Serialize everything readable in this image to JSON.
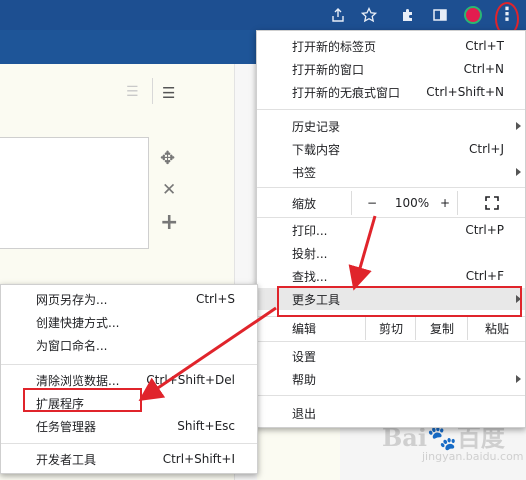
{
  "toolbar": {
    "icons": [
      "share-icon",
      "star-icon",
      "extensions-icon",
      "side-panel-icon",
      "profile-avatar",
      "more-menu-icon"
    ],
    "profile_ring_color": "#2bb673",
    "profile_fill_color": "#e21d4f",
    "more_icon_glyph": "⋮"
  },
  "main_menu": {
    "new_tab": {
      "label": "打开新的标签页",
      "shortcut": "Ctrl+T"
    },
    "new_window": {
      "label": "打开新的窗口",
      "shortcut": "Ctrl+N"
    },
    "new_incognito": {
      "label": "打开新的无痕式窗口",
      "shortcut": "Ctrl+Shift+N"
    },
    "history": {
      "label": "历史记录"
    },
    "downloads": {
      "label": "下载内容",
      "shortcut": "Ctrl+J"
    },
    "bookmarks": {
      "label": "书签"
    },
    "zoom": {
      "label": "缩放",
      "minus": "−",
      "level": "100%",
      "plus": "+"
    },
    "print": {
      "label": "打印...",
      "shortcut": "Ctrl+P"
    },
    "cast": {
      "label": "投射..."
    },
    "find": {
      "label": "查找...",
      "shortcut": "Ctrl+F"
    },
    "more_tools": {
      "label": "更多工具"
    },
    "edit": {
      "label": "编辑",
      "cut": "剪切",
      "copy": "复制",
      "paste": "粘贴"
    },
    "settings": {
      "label": "设置"
    },
    "help": {
      "label": "帮助"
    },
    "exit": {
      "label": "退出"
    }
  },
  "sub_menu": {
    "save_page": {
      "label": "网页另存为...",
      "shortcut": "Ctrl+S"
    },
    "create_shortcut": {
      "label": "创建快捷方式..."
    },
    "name_window": {
      "label": "为窗口命名..."
    },
    "clear_data": {
      "label": "清除浏览数据...",
      "shortcut": "Ctrl+Shift+Del"
    },
    "extensions": {
      "label": "扩展程序"
    },
    "task_manager": {
      "label": "任务管理器",
      "shortcut": "Shift+Esc"
    },
    "dev_tools": {
      "label": "开发者工具",
      "shortcut": "Ctrl+Shift+I"
    }
  },
  "watermark": {
    "text": "Bai🐾百度",
    "sub": "jingyan.baidu.com"
  },
  "colors": {
    "highlight": "#e8e8e8",
    "annotation_red": "#e0242b",
    "page_header_blue": "#1e5598"
  }
}
